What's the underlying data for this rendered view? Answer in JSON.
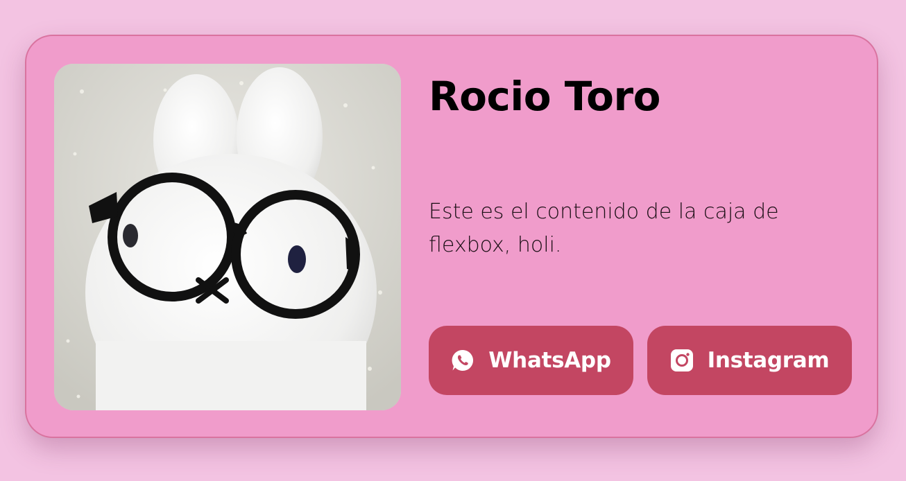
{
  "profile": {
    "name": "Rocio Toro",
    "description": "Este es el contenido de la caja de flexbox, holi.",
    "photo_subject": "white plush bunny wearing black round glasses"
  },
  "buttons": {
    "whatsapp": {
      "label": "WhatsApp",
      "icon": "whatsapp-icon"
    },
    "instagram": {
      "label": "Instagram",
      "icon": "instagram-icon"
    }
  },
  "colors": {
    "page_background": "#f3c3e2",
    "card_background": "#f09ccb",
    "card_border": "#d9739f",
    "button_background": "#c34662",
    "button_text": "#ffffff",
    "title_text": "#000000"
  }
}
